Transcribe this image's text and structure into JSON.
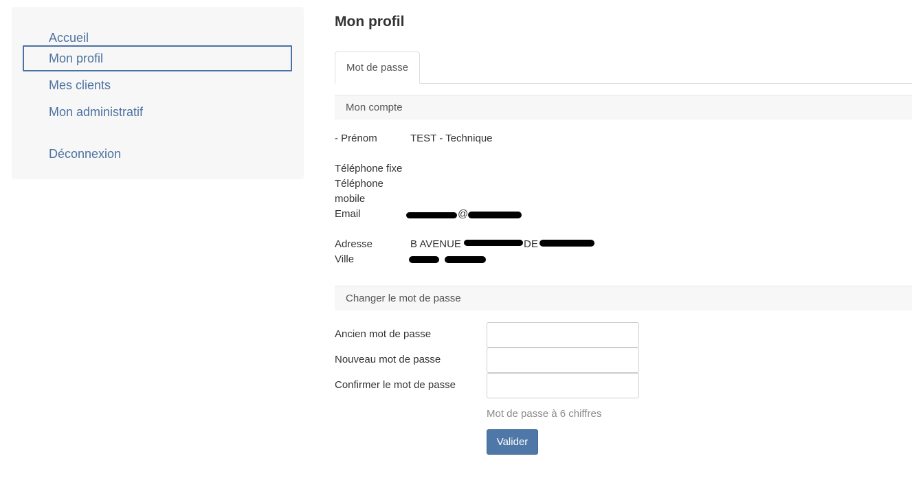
{
  "sidebar": {
    "items": [
      {
        "label": "Accueil"
      },
      {
        "label": "Mon profil"
      },
      {
        "label": "Mes clients"
      },
      {
        "label": "Mon administratif"
      },
      {
        "label": "Déconnexion"
      }
    ]
  },
  "page": {
    "title": "Mon profil",
    "tab_label": "Mot de passe"
  },
  "account": {
    "section_title": "Mon compte",
    "fields": [
      {
        "label": "- Prénom",
        "value": "TEST - Technique"
      },
      {
        "label": "Téléphone fixe",
        "value": ""
      },
      {
        "label": "Téléphone",
        "value": ""
      },
      {
        "label": "mobile",
        "value": ""
      },
      {
        "label": "Email",
        "value": "@"
      },
      {
        "label": "Adresse",
        "value": "B AVENUE"
      },
      {
        "label": "Ville",
        "value": ""
      }
    ],
    "address_extra": "DE"
  },
  "password": {
    "section_title": "Changer le mot de passe",
    "old_label": "Ancien mot de passe",
    "new_label": "Nouveau mot de passe",
    "confirm_label": "Confirmer le mot de passe",
    "old_value": "",
    "new_value": "",
    "confirm_value": "",
    "hint": "Mot de passe à 6 chiffres",
    "submit_label": "Valider"
  },
  "colors": {
    "link": "#4d72a1",
    "button": "#4f78a8",
    "panel": "#f7f7f7"
  }
}
